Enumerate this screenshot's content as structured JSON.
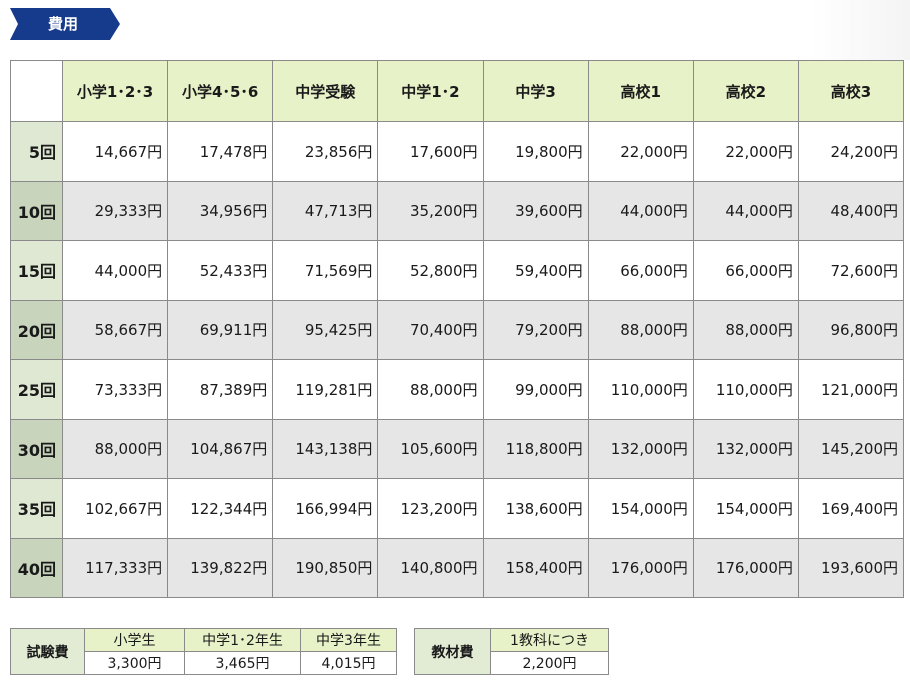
{
  "section_title": "費用",
  "fee_table": {
    "columns": [
      "小学1･2･3",
      "小学4･5･6",
      "中学受験",
      "中学1･2",
      "中学3",
      "高校1",
      "高校2",
      "高校3"
    ],
    "rows": [
      {
        "label": "5回",
        "cells": [
          "14,667円",
          "17,478円",
          "23,856円",
          "17,600円",
          "19,800円",
          "22,000円",
          "22,000円",
          "24,200円"
        ]
      },
      {
        "label": "10回",
        "cells": [
          "29,333円",
          "34,956円",
          "47,713円",
          "35,200円",
          "39,600円",
          "44,000円",
          "44,000円",
          "48,400円"
        ]
      },
      {
        "label": "15回",
        "cells": [
          "44,000円",
          "52,433円",
          "71,569円",
          "52,800円",
          "59,400円",
          "66,000円",
          "66,000円",
          "72,600円"
        ]
      },
      {
        "label": "20回",
        "cells": [
          "58,667円",
          "69,911円",
          "95,425円",
          "70,400円",
          "79,200円",
          "88,000円",
          "88,000円",
          "96,800円"
        ]
      },
      {
        "label": "25回",
        "cells": [
          "73,333円",
          "87,389円",
          "119,281円",
          "88,000円",
          "99,000円",
          "110,000円",
          "110,000円",
          "121,000円"
        ]
      },
      {
        "label": "30回",
        "cells": [
          "88,000円",
          "104,867円",
          "143,138円",
          "105,600円",
          "118,800円",
          "132,000円",
          "132,000円",
          "145,200円"
        ]
      },
      {
        "label": "35回",
        "cells": [
          "102,667円",
          "122,344円",
          "166,994円",
          "123,200円",
          "138,600円",
          "154,000円",
          "154,000円",
          "169,400円"
        ]
      },
      {
        "label": "40回",
        "cells": [
          "117,333円",
          "139,822円",
          "190,850円",
          "140,800円",
          "158,400円",
          "176,000円",
          "176,000円",
          "193,600円"
        ]
      }
    ]
  },
  "exam_fee": {
    "label": "試験費",
    "columns": [
      "小学生",
      "中学1･2年生",
      "中学3年生"
    ],
    "values": [
      "3,300円",
      "3,465円",
      "4,015円"
    ]
  },
  "material_fee": {
    "label": "教材費",
    "column": "1教科につき",
    "value": "2,200円"
  }
}
